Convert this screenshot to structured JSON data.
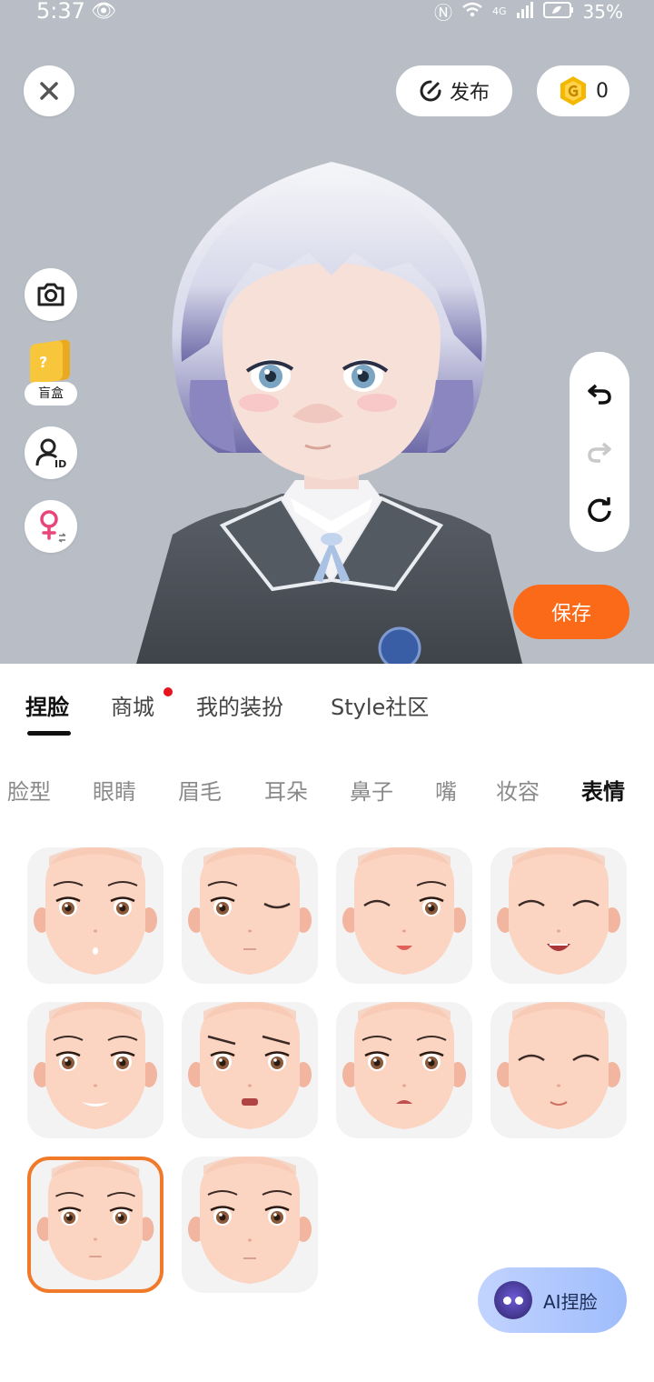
{
  "status_bar": {
    "time": "5:37",
    "network": "4G",
    "battery": "35%"
  },
  "top": {
    "publish_label": "发布",
    "coins": "0"
  },
  "side": {
    "blind_box_label": "盲盒"
  },
  "save_label": "保存",
  "tabs": [
    {
      "label": "捏脸",
      "active": true
    },
    {
      "label": "商城",
      "active": false,
      "badge": true
    },
    {
      "label": "我的装扮",
      "active": false
    },
    {
      "label": "Style社区",
      "active": false
    }
  ],
  "subtabs": [
    {
      "label": "脸型",
      "active": false
    },
    {
      "label": "眼睛",
      "active": false
    },
    {
      "label": "眉毛",
      "active": false
    },
    {
      "label": "耳朵",
      "active": false
    },
    {
      "label": "鼻子",
      "active": false
    },
    {
      "label": "嘴",
      "active": false
    },
    {
      "label": "妆容",
      "active": false
    },
    {
      "label": "表情",
      "active": true
    }
  ],
  "expressions": [
    {
      "name": "neutral-smile",
      "selected": false
    },
    {
      "name": "wink",
      "selected": false
    },
    {
      "name": "happy-tongue",
      "selected": false
    },
    {
      "name": "laugh",
      "selected": false
    },
    {
      "name": "worried-grin",
      "selected": false
    },
    {
      "name": "angry",
      "selected": false
    },
    {
      "name": "sad",
      "selected": false
    },
    {
      "name": "content",
      "selected": false
    },
    {
      "name": "default",
      "selected": true
    },
    {
      "name": "calm",
      "selected": false
    }
  ],
  "ai_button_label": "AI捏脸",
  "colors": {
    "accent": "#fb6a18",
    "stage_bg": "#b9bec6",
    "selected_border": "#f07a2a"
  }
}
